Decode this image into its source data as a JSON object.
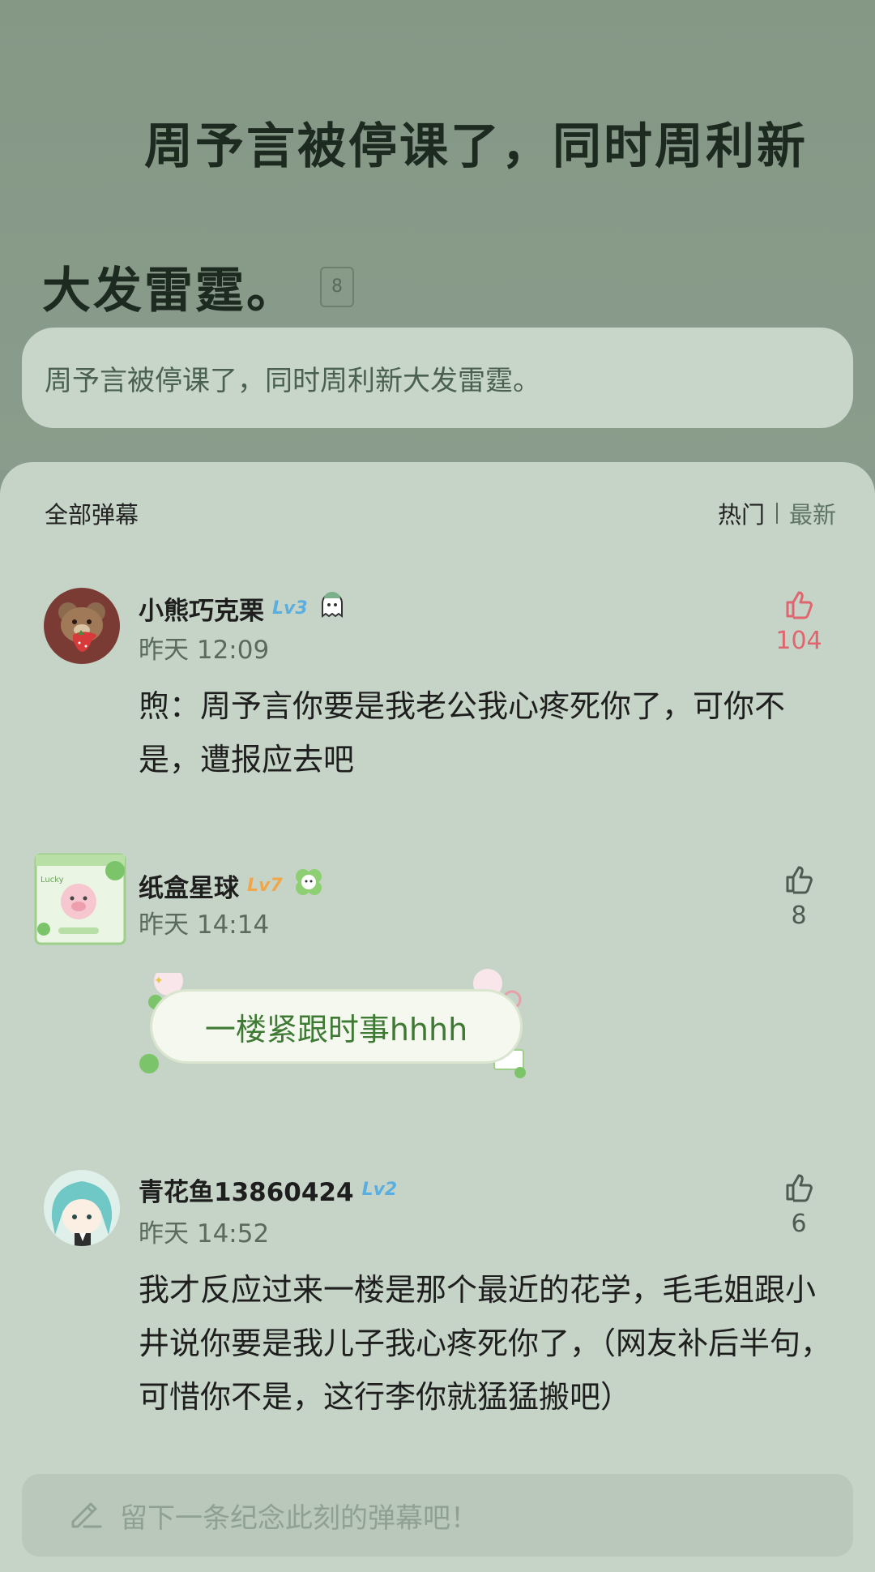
{
  "header": {
    "title_line1": "周予言被停课了，同时周利新",
    "title_line2": "大发雷霆。",
    "note_count": "8",
    "excerpt": "周予言被停课了，同时周利新大发雷霆。"
  },
  "panel": {
    "title": "全部弹幕",
    "sort_hot": "热门",
    "sort_new": "最新"
  },
  "comments": [
    {
      "username": "小熊巧克栗",
      "level": "Lv3",
      "time": "昨天 12:09",
      "likes": "104",
      "liked": true,
      "text": "煦：周予言你要是我老公我心疼死你了，可你不是，遭报应去吧"
    },
    {
      "username": "纸盒星球",
      "level": "Lv7",
      "time": "昨天 14:14",
      "likes": "8",
      "liked": false,
      "text": "一楼紧跟时事hhhh"
    },
    {
      "username": "青花鱼13860424",
      "level": "Lv2",
      "time": "昨天 14:52",
      "likes": "6",
      "liked": false,
      "text": "我才反应过来一楼是那个最近的花学，毛毛姐跟小井说你要是我儿子我心疼死你了，（网友补后半句，可惜你不是，这行李你就猛猛搬吧）"
    }
  ],
  "input": {
    "placeholder": "留下一条纪念此刻的弹幕吧！"
  },
  "colors": {
    "like_active": "#e0656e",
    "level_blue": "#5aaee0",
    "level_orange": "#f0a64a",
    "bubble_text": "#3f7a35"
  }
}
